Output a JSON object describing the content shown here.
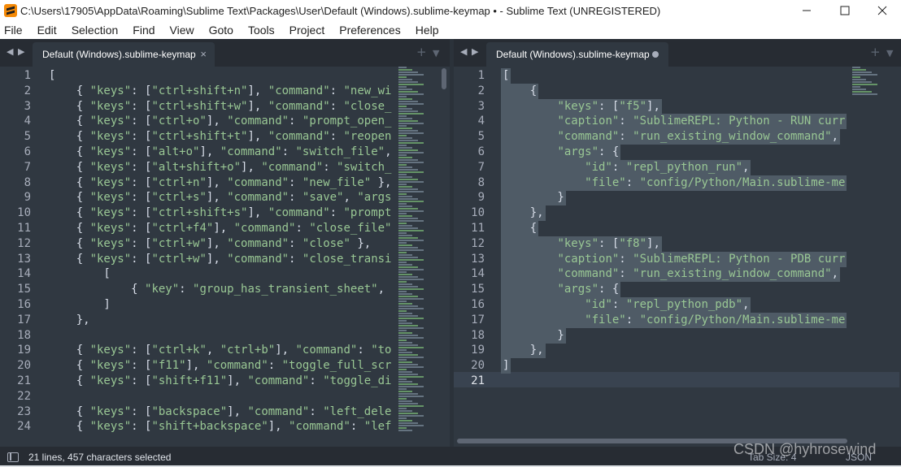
{
  "window": {
    "title": "C:\\Users\\17905\\AppData\\Roaming\\Sublime Text\\Packages\\User\\Default (Windows).sublime-keymap • - Sublime Text (UNREGISTERED)"
  },
  "menu": [
    "File",
    "Edit",
    "Selection",
    "Find",
    "View",
    "Goto",
    "Tools",
    "Project",
    "Preferences",
    "Help"
  ],
  "left_pane": {
    "tab_label": "Default (Windows).sublime-keymap",
    "close_glyph": "×",
    "line_numbers": [
      "1",
      "2",
      "3",
      "4",
      "5",
      "6",
      "7",
      "8",
      "9",
      "10",
      "11",
      "12",
      "13",
      "14",
      "15",
      "16",
      "17",
      "18",
      "19",
      "20",
      "21",
      "22",
      "23",
      "24"
    ],
    "lines": [
      "[",
      "    { \"keys\": [\"ctrl+shift+n\"], \"command\": \"new_wi",
      "    { \"keys\": [\"ctrl+shift+w\"], \"command\": \"close_",
      "    { \"keys\": [\"ctrl+o\"], \"command\": \"prompt_open_",
      "    { \"keys\": [\"ctrl+shift+t\"], \"command\": \"reopen",
      "    { \"keys\": [\"alt+o\"], \"command\": \"switch_file\",",
      "    { \"keys\": [\"alt+shift+o\"], \"command\": \"switch_",
      "    { \"keys\": [\"ctrl+n\"], \"command\": \"new_file\" },",
      "    { \"keys\": [\"ctrl+s\"], \"command\": \"save\", \"args",
      "    { \"keys\": [\"ctrl+shift+s\"], \"command\": \"prompt",
      "    { \"keys\": [\"ctrl+f4\"], \"command\": \"close_file\"",
      "    { \"keys\": [\"ctrl+w\"], \"command\": \"close\" },",
      "    { \"keys\": [\"ctrl+w\"], \"command\": \"close_transi",
      "        [",
      "            { \"key\": \"group_has_transient_sheet\",",
      "        ]",
      "    },",
      "",
      "    { \"keys\": [\"ctrl+k\", \"ctrl+b\"], \"command\": \"to",
      "    { \"keys\": [\"f11\"], \"command\": \"toggle_full_scr",
      "    { \"keys\": [\"shift+f11\"], \"command\": \"toggle_di",
      "",
      "    { \"keys\": [\"backspace\"], \"command\": \"left_dele",
      "    { \"keys\": [\"shift+backspace\"], \"command\": \"lef"
    ]
  },
  "right_pane": {
    "tab_label": "Default (Windows).sublime-keymap",
    "line_numbers": [
      "1",
      "2",
      "3",
      "4",
      "5",
      "6",
      "7",
      "8",
      "9",
      "10",
      "11",
      "12",
      "13",
      "14",
      "15",
      "16",
      "17",
      "18",
      "19",
      "20",
      "21"
    ],
    "lines": [
      "[",
      "    {",
      "        \"keys\": [\"f5\"],",
      "        \"caption\": \"SublimeREPL: Python - RUN curr",
      "        \"command\": \"run_existing_window_command\",",
      "        \"args\": {",
      "            \"id\": \"repl_python_run\",",
      "            \"file\": \"config/Python/Main.sublime-me",
      "        }",
      "    },",
      "    {",
      "        \"keys\": [\"f8\"],",
      "        \"caption\": \"SublimeREPL: Python - PDB curr",
      "        \"command\": \"run_existing_window_command\",",
      "        \"args\": {",
      "            \"id\": \"repl_python_pdb\",",
      "            \"file\": \"config/Python/Main.sublime-me",
      "        }",
      "    },",
      "]",
      ""
    ]
  },
  "status": {
    "selection_text": "21 lines, 457 characters selected",
    "tab_size": "Tab Size: 4",
    "syntax": "JSON"
  },
  "watermark": "CSDN @hyhrosewind",
  "colors": {
    "background": "#303841",
    "string": "#99c794",
    "selection": "#4f5b66",
    "gutter_text": "#a7adba"
  }
}
